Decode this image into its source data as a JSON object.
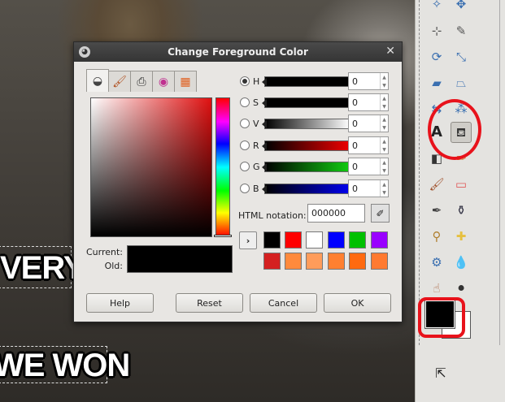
{
  "canvas": {
    "meme_line1": "VERY",
    "meme_line2": "WE WON"
  },
  "dialog": {
    "title": "Change Foreground Color",
    "tabs": [
      "gimp-selector-icon",
      "watercolor-brush-icon",
      "printer-cmyk-icon",
      "color-wheel-icon",
      "palette-icon"
    ],
    "current_label": "Current:",
    "old_label": "Old:",
    "current_color": "#000000",
    "sliders": [
      {
        "label": "H",
        "value": "0",
        "checked": true
      },
      {
        "label": "S",
        "value": "0",
        "checked": false
      },
      {
        "label": "V",
        "value": "0",
        "checked": false
      },
      {
        "label": "R",
        "value": "0",
        "checked": false
      },
      {
        "label": "G",
        "value": "0",
        "checked": false
      },
      {
        "label": "B",
        "value": "0",
        "checked": false
      }
    ],
    "html_notation_label": "HTML notation:",
    "html_notation_value": "000000",
    "history_row1": [
      "#000000",
      "#ff0000",
      "#ffffff",
      "#0000ff",
      "#00c000",
      "#9900ff"
    ],
    "history_row2": [
      "#d42020",
      "#ff8a3c",
      "#ff9c5a",
      "#ff8030",
      "#ff6a10",
      "#ff7a30"
    ],
    "buttons": {
      "help": "Help",
      "reset": "Reset",
      "cancel": "Cancel",
      "ok": "OK"
    }
  },
  "toolbox": {
    "foreground_color": "#000000",
    "background_color": "#ffffff",
    "annotation_color": "#e8121b"
  }
}
